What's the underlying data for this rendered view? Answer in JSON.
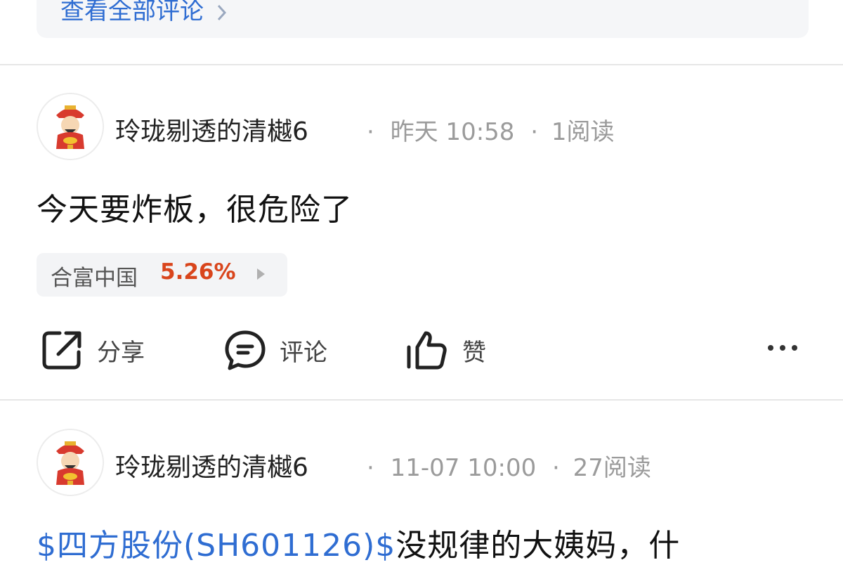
{
  "comments_section": {
    "view_all_label": "查看全部评论"
  },
  "posts": [
    {
      "author": "玲珑剔透的清樾6",
      "time": "昨天 10:58",
      "reads": "1阅读",
      "content": "今天要炸板，很危险了",
      "stock": {
        "name": "合富中国",
        "change": "5.26%"
      },
      "actions": {
        "share": "分享",
        "comment": "评论",
        "like": "赞"
      }
    },
    {
      "author": "玲珑剔透的清樾6",
      "time": "11-07 10:00",
      "reads": "27阅读",
      "content_link": "$四方股份(SH601126)$",
      "content_rest": "没规律的大姨妈，什"
    }
  ],
  "separator": "·",
  "colors": {
    "link": "#2f6dd2",
    "gain": "#d9451c",
    "card_bg": "#f5f6f8"
  },
  "icons": [
    "chevron-right-icon",
    "share-icon",
    "comment-icon",
    "like-icon",
    "more-icon"
  ]
}
